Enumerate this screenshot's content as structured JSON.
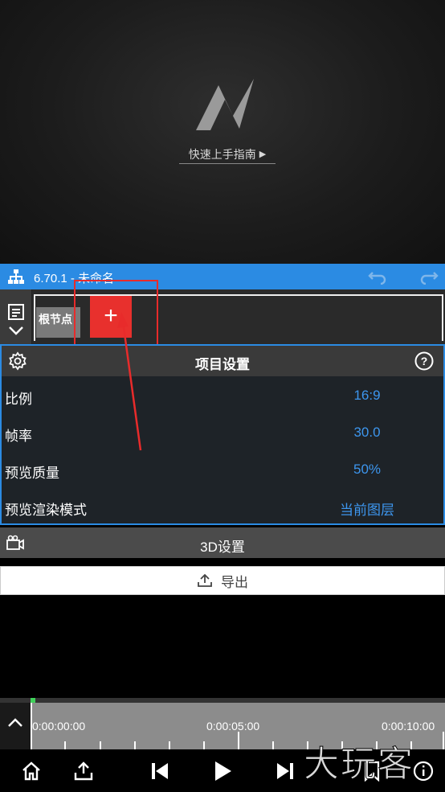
{
  "preview": {
    "logo_icon": "n-logo-icon",
    "guide_label": "快速上手指南"
  },
  "titlebar": {
    "title": "6.70.1 - 未命名",
    "color": "#2b8be3"
  },
  "nodes": {
    "root_label": "根节点",
    "add_label": "+"
  },
  "project_settings": {
    "title": "项目设置",
    "rows": [
      {
        "label": "比例",
        "value": "16:9"
      },
      {
        "label": "帧率",
        "value": "30.0"
      },
      {
        "label": "预览质量",
        "value": "50%"
      },
      {
        "label": "预览渲染模式",
        "value": "当前图层"
      }
    ]
  },
  "three_d": {
    "label": "3D设置"
  },
  "export": {
    "label": "导出"
  },
  "timeline": {
    "marks": [
      "0:00:00:00",
      "0:00:05:00",
      "0:00:10:00"
    ]
  },
  "watermark": "大玩客"
}
